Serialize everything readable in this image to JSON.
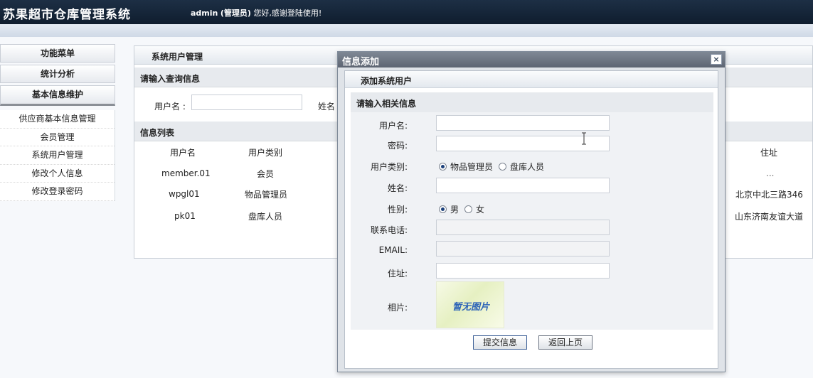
{
  "header": {
    "app_title": "苏果超市仓库管理系统",
    "user": "admin",
    "role": "(管理员)",
    "greeting": "您好,感谢登陆使用!"
  },
  "sidebar": {
    "menus": [
      "功能菜单",
      "统计分析",
      "基本信息维护"
    ],
    "items": [
      "供应商基本信息管理",
      "会员管理",
      "系统用户管理",
      "修改个人信息",
      "修改登录密码"
    ]
  },
  "main": {
    "title": "系统用户管理",
    "query_section": "请输入查询信息",
    "query_username_label": "用户名 :",
    "query_name_label": "姓名",
    "list_section": "信息列表",
    "columns": [
      "用户名",
      "用户类别",
      "住址"
    ],
    "rows": [
      {
        "username": "member.01",
        "type": "会员",
        "address": "..."
      },
      {
        "username": "wpgl01",
        "type": "物品管理员",
        "address": "北京中北三路346"
      },
      {
        "username": "pk01",
        "type": "盘库人员",
        "address": "山东济南友谊大道"
      }
    ]
  },
  "dialog": {
    "title": "信息添加",
    "close": "×",
    "header": "添加系统用户",
    "section": "请输入相关信息",
    "labels": {
      "username": "用户名:",
      "password": "密码:",
      "user_type": "用户类别:",
      "name": "姓名:",
      "gender": "性别:",
      "phone": "联系电话:",
      "email": "EMAIL:",
      "address": "住址:",
      "photo": "相片:"
    },
    "user_type_options": [
      "物品管理员",
      "盘库人员"
    ],
    "gender_options": [
      "男",
      "女"
    ],
    "photo_placeholder": "暂无图片",
    "submit": "提交信息",
    "back": "返回上页"
  }
}
